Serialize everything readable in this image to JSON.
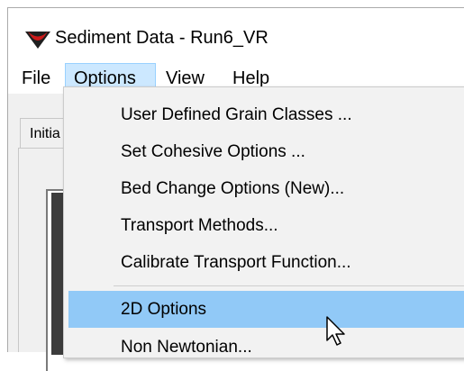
{
  "window": {
    "title": "Sediment Data - Run6_VR"
  },
  "menubar": {
    "items": [
      "File",
      "Options",
      "View",
      "Help"
    ]
  },
  "tabs": {
    "visible_partial_label": "Initia"
  },
  "options_menu": {
    "items": [
      "User Defined Grain Classes ...",
      "Set Cohesive Options ...",
      "Bed Change Options (New)...",
      "Transport Methods...",
      "Calibrate Transport Function...",
      "2D Options",
      "Non Newtonian..."
    ],
    "highlighted": "2D Options"
  },
  "icons": {
    "app": "sediment-app-icon",
    "cursor": "mouse-pointer-icon"
  },
  "colors": {
    "menu_active_bg": "#cce8ff",
    "menu_highlight_bg": "#91c9f7",
    "icon_red": "#cc1a1a",
    "icon_dark": "#1f1f1f"
  }
}
